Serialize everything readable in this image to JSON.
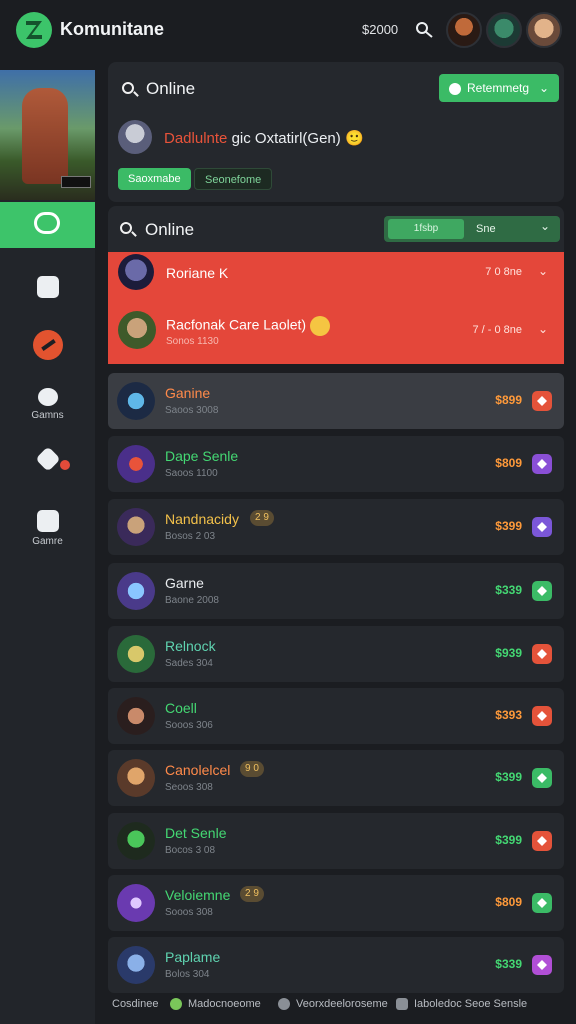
{
  "header": {
    "title": "Komunitane",
    "coins": "$2000",
    "icon": "controller-icon"
  },
  "sidebar": {
    "items": [
      {
        "label": "",
        "icon": "chat-icon"
      },
      {
        "label": "",
        "icon": "list-icon"
      },
      {
        "label": "",
        "icon": "no-entry-icon"
      },
      {
        "label": "Gamns",
        "icon": "group-icon"
      },
      {
        "label": "",
        "icon": "rocket-icon"
      },
      {
        "label": "Gamre",
        "icon": "controller-icon"
      }
    ]
  },
  "online_panel": {
    "title": "Online",
    "button": "Retemmetg",
    "user_name": "Dadlulnte",
    "user_status": "gic Oxtatirl(Gen)",
    "emoji": "🙂",
    "pill_primary": "Saoxmabe",
    "pill_secondary": "Seonefome"
  },
  "friends_panel": {
    "title": "Online",
    "filter_left": "1fsbp",
    "filter_right": "Sne"
  },
  "requests": [
    {
      "name": "Roriane K",
      "time": "7 0 8ne",
      "sub": ""
    },
    {
      "name": "Racfonak Care Laolet)",
      "time": "7 / - 0 8ne",
      "sub": "Sonos 1130"
    }
  ],
  "list": [
    {
      "name": "Ganine",
      "sub": "Saoos 3008",
      "price": "$899",
      "name_color": "#ff8a4a",
      "price_color": "#ff9a3a",
      "action_color": "#e4533a",
      "tag": ""
    },
    {
      "name": "Dape Senle",
      "sub": "Saoos 1100",
      "price": "$809",
      "name_color": "#44d873",
      "price_color": "#ff9a3a",
      "action_color": "#8a4fd6",
      "tag": ""
    },
    {
      "name": "Nandnacidy",
      "sub": "Bosos 2 03",
      "price": "$399",
      "name_color": "#f3c14a",
      "price_color": "#ff9a3a",
      "action_color": "#7b57d8",
      "tag": "2 9"
    },
    {
      "name": "Garne",
      "sub": "Baone 2008",
      "price": "$339",
      "name_color": "#e9ecef",
      "price_color": "#44d873",
      "action_color": "#3bbb66",
      "tag": ""
    },
    {
      "name": "Relnock",
      "sub": "Sades 304",
      "price": "$939",
      "name_color": "#5fd3b0",
      "price_color": "#44d873",
      "action_color": "#e4533a",
      "tag": ""
    },
    {
      "name": "Coell",
      "sub": "Sooos 306",
      "price": "$393",
      "name_color": "#44d873",
      "price_color": "#ff9a3a",
      "action_color": "#e4533a",
      "tag": ""
    },
    {
      "name": "Canolelcel",
      "sub": "Seoos 308",
      "price": "$399",
      "name_color": "#ff8a4a",
      "price_color": "#44d873",
      "action_color": "#3bbb66",
      "tag": "9 0"
    },
    {
      "name": "Det Senle",
      "sub": "Bocos 3 08",
      "price": "$399",
      "name_color": "#44d873",
      "price_color": "#44d873",
      "action_color": "#e4533a",
      "tag": ""
    },
    {
      "name": "Veloiemne",
      "sub": "Sooos 308",
      "price": "$809",
      "name_color": "#44d873",
      "price_color": "#ff9a3a",
      "action_color": "#3bbb66",
      "tag": "2 9"
    },
    {
      "name": "Paplame",
      "sub": "Bolos 304",
      "price": "$339",
      "name_color": "#5fd3b0",
      "price_color": "#44d873",
      "action_color": "#b14fd6",
      "tag": ""
    }
  ],
  "footer": {
    "left": "Cosdinee",
    "item1": "Madocnoeome",
    "item2": "Veorxdeeloroseme",
    "item3": "Iaboledoc Seoe Sensle"
  }
}
